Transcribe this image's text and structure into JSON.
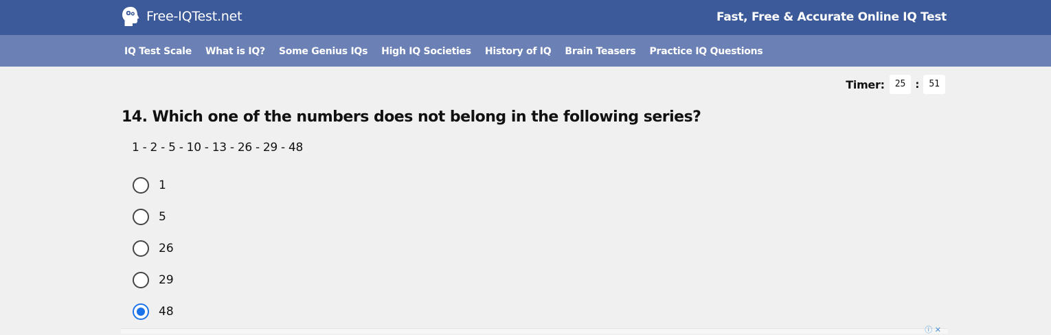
{
  "header": {
    "brand": "Free-IQTest.net",
    "tagline": "Fast, Free & Accurate Online IQ Test",
    "brand_color": "#3c5a9a"
  },
  "nav": {
    "items": [
      {
        "label": "IQ Test Scale"
      },
      {
        "label": "What is IQ?"
      },
      {
        "label": "Some Genius IQs"
      },
      {
        "label": "High IQ Societies"
      },
      {
        "label": "History of IQ"
      },
      {
        "label": "Brain Teasers"
      },
      {
        "label": "Practice IQ Questions"
      }
    ],
    "bar_color": "#6b80b4"
  },
  "timer": {
    "label": "Timer:",
    "minutes": "25",
    "separator": ":",
    "seconds": "51"
  },
  "question": {
    "title": "14. Which one of the numbers does not belong in the following series?",
    "series": "1 - 2 - 5 - 10 - 13 - 26 - 29 - 48",
    "options": [
      {
        "label": "1",
        "selected": false
      },
      {
        "label": "5",
        "selected": false
      },
      {
        "label": "26",
        "selected": false
      },
      {
        "label": "29",
        "selected": false
      },
      {
        "label": "48",
        "selected": true
      }
    ],
    "selected_color": "#1a73e8"
  },
  "ad": {
    "info_icon": "adchoices-icon",
    "close_icon": "close-icon"
  }
}
